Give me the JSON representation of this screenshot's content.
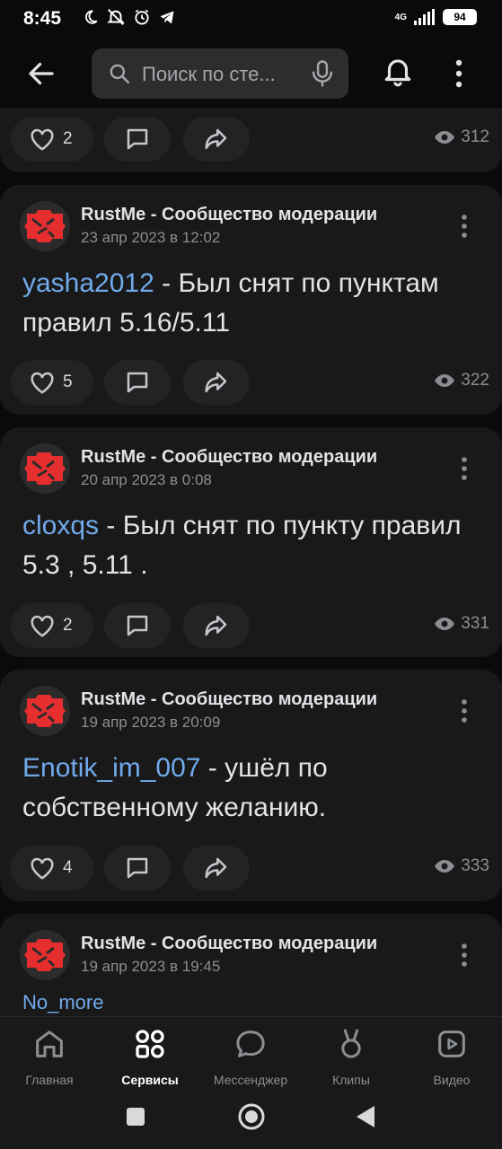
{
  "status_bar": {
    "time": "8:45",
    "network": "4G",
    "battery": "94"
  },
  "header": {
    "search_placeholder": "Поиск по сте..."
  },
  "posts": [
    {
      "likes": "2",
      "views": "312"
    },
    {
      "author": "RustMe - Сообщество модерации",
      "date": "23 апр 2023 в 12:02",
      "mention": "yasha2012",
      "text": " - Был снят по пунктам правил 5.16/5.11",
      "likes": "5",
      "views": "322"
    },
    {
      "author": "RustMe - Сообщество модерации",
      "date": "20 апр 2023 в 0:08",
      "mention": "cloxqs",
      "text": " - Был снят по пункту правил 5.3 , 5.11 .",
      "likes": "2",
      "views": "331"
    },
    {
      "author": "RustMe - Сообщество модерации",
      "date": "19 апр 2023 в 20:09",
      "mention": "Enotik_im_007",
      "text": " - ушёл по собственному желанию.",
      "likes": "4",
      "views": "333"
    },
    {
      "author": "RustMe - Сообщество модерации",
      "date": "19 апр 2023 в 19:45",
      "mention": "No_more"
    }
  ],
  "bottom_nav": [
    {
      "label": "Главная",
      "icon": "home-icon"
    },
    {
      "label": "Сервисы",
      "icon": "services-icon",
      "active": true
    },
    {
      "label": "Мессенджер",
      "icon": "messenger-icon"
    },
    {
      "label": "Клипы",
      "icon": "clips-icon"
    },
    {
      "label": "Видео",
      "icon": "video-icon"
    }
  ],
  "colors": {
    "background": "#0a0a0a",
    "card": "#19191a",
    "pill": "#232324",
    "mention": "#71aaeb",
    "avatar_red": "#e62e2e"
  }
}
